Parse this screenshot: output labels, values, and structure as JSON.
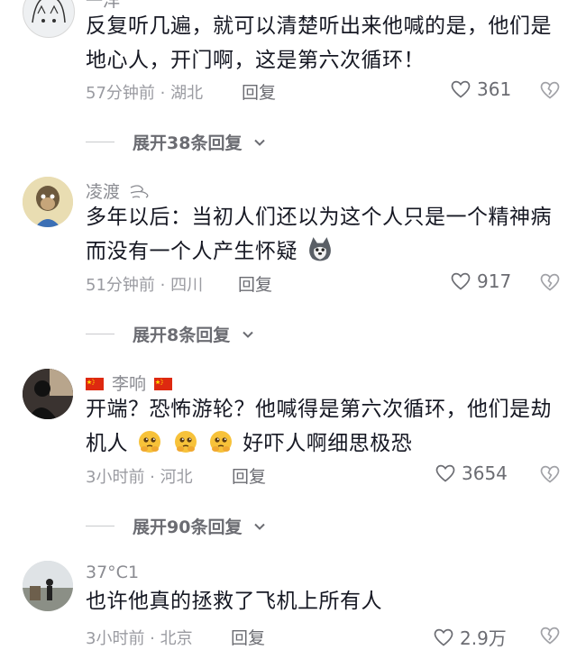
{
  "comments": [
    {
      "username": "一洋",
      "text": "反复听几遍，就可以清楚听出来他喊的是，他们是地心人，开门啊，这是第六次循环！",
      "time_location": "57分钟前 · 湖北",
      "reply_label": "回复",
      "likes": "361",
      "expand_label": "展开38条回复"
    },
    {
      "username": "凌渡",
      "text": "多年以后：当初人们还以为这个人只是一个精神病而没有一个人产生怀疑",
      "time_location": "51分钟前 · 四川",
      "reply_label": "回复",
      "likes": "917",
      "expand_label": "展开8条回复"
    },
    {
      "username": "李响",
      "text_part1": "开端？恐怖游轮？他喊得是第六次循环，他们是劫机人",
      "text_part2": "好吓人啊细思极恐",
      "time_location": "3小时前 · 河北",
      "reply_label": "回复",
      "likes": "3654",
      "expand_label": "展开90条回复"
    },
    {
      "username": "37°C1",
      "text": "也许他真的拯救了飞机上所有人",
      "time_location": "3小时前 · 北京",
      "reply_label": "回复",
      "likes": "2.9万"
    }
  ],
  "icons": {
    "like": "heart-outline-icon",
    "dislike": "broken-heart-icon",
    "expand": "chevron-down-icon",
    "user_badge": "wind-swirl-icon",
    "flag": "china-flag-icon",
    "emoji_husky": "husky-emoji",
    "emoji_thinking": "pleading-face-emoji"
  },
  "colors": {
    "text_primary": "#161823",
    "text_secondary": "#8a8b91",
    "meta": "#9a9ba1",
    "flag_red": "#de2910",
    "flag_yellow": "#ffde00",
    "emoji_yellow": "#f7c23a"
  }
}
